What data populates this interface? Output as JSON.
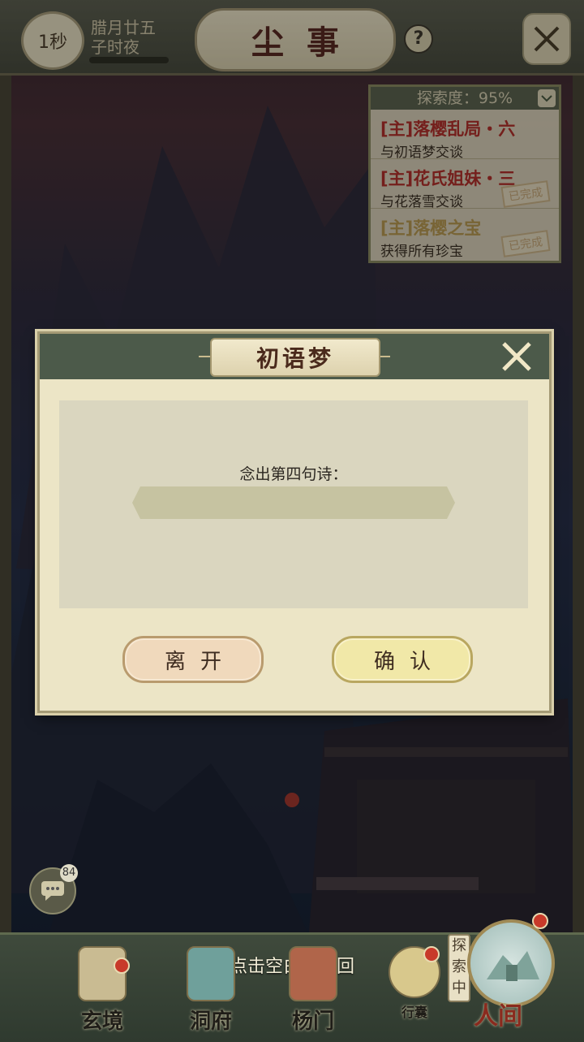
{
  "topbar": {
    "timer": "1秒",
    "date_line1": "腊月廿五",
    "date_line2": "子时夜",
    "title": "尘事",
    "help": "?"
  },
  "quest_panel": {
    "progress": "探索度：95%",
    "items": [
      {
        "title": "[主]落樱乱局・六",
        "sub": "与初语梦交谈",
        "done": false
      },
      {
        "title": "[主]花氏姐妹・三",
        "sub": "与花落雪交谈",
        "done": true,
        "stamp": "已完成"
      },
      {
        "title": "[主]落樱之宝",
        "sub": "获得所有珍宝",
        "done": true,
        "stamp": "已完成"
      }
    ]
  },
  "chat": {
    "badge": "84"
  },
  "dialog": {
    "title": "初语梦",
    "prompt": "念出第四句诗：",
    "input_value": "",
    "leave_label": "离开",
    "confirm_label": "确认"
  },
  "bottom_nav": {
    "hint": "点击空白处返回",
    "items": [
      {
        "label": "玄境",
        "icon": "scroll-icon",
        "has_dot": true
      },
      {
        "label": "洞府",
        "icon": "cave-icon",
        "has_dot": false
      },
      {
        "label": "杨门",
        "icon": "gate-icon",
        "has_dot": false
      },
      {
        "label": "行囊",
        "icon": "bag-icon",
        "has_dot": true
      }
    ],
    "explore_tag": "探索中",
    "world_label": "人间"
  },
  "colors": {
    "accent_red": "#b3302b",
    "panel_bg": "#ece5c6",
    "header_green": "#4c5a4a"
  }
}
